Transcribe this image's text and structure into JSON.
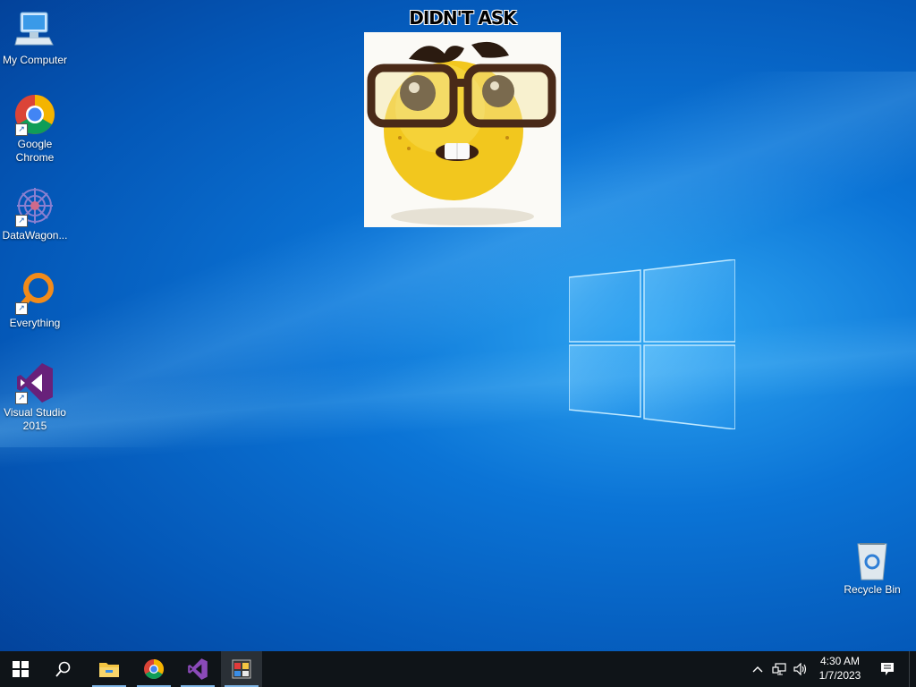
{
  "desktop": {
    "icons": [
      {
        "label": "My Computer",
        "icon": "computer-icon"
      },
      {
        "label": "Google Chrome",
        "icon": "chrome-icon"
      },
      {
        "label": "DataWagon...",
        "icon": "datawagon-icon"
      },
      {
        "label": "Everything",
        "icon": "everything-search-icon"
      },
      {
        "label": "Visual Studio 2015",
        "icon": "visual-studio-icon"
      },
      {
        "label": "Recycle Bin",
        "icon": "recycle-bin-icon"
      }
    ]
  },
  "meme": {
    "caption": "DIDN'T ASK"
  },
  "taskbar": {
    "buttons": [
      "start-icon",
      "search-icon",
      "file-explorer-icon",
      "chrome-icon",
      "visual-studio-icon",
      "app-icon"
    ],
    "clock": {
      "time": "4:30 AM",
      "date": "1/7/2023"
    },
    "tray_icons": [
      "chevron-up-icon",
      "network-icon",
      "volume-icon",
      "notification-icon"
    ]
  },
  "colors": {
    "accent": "#0b74d6",
    "taskbar": "#0f1418"
  }
}
